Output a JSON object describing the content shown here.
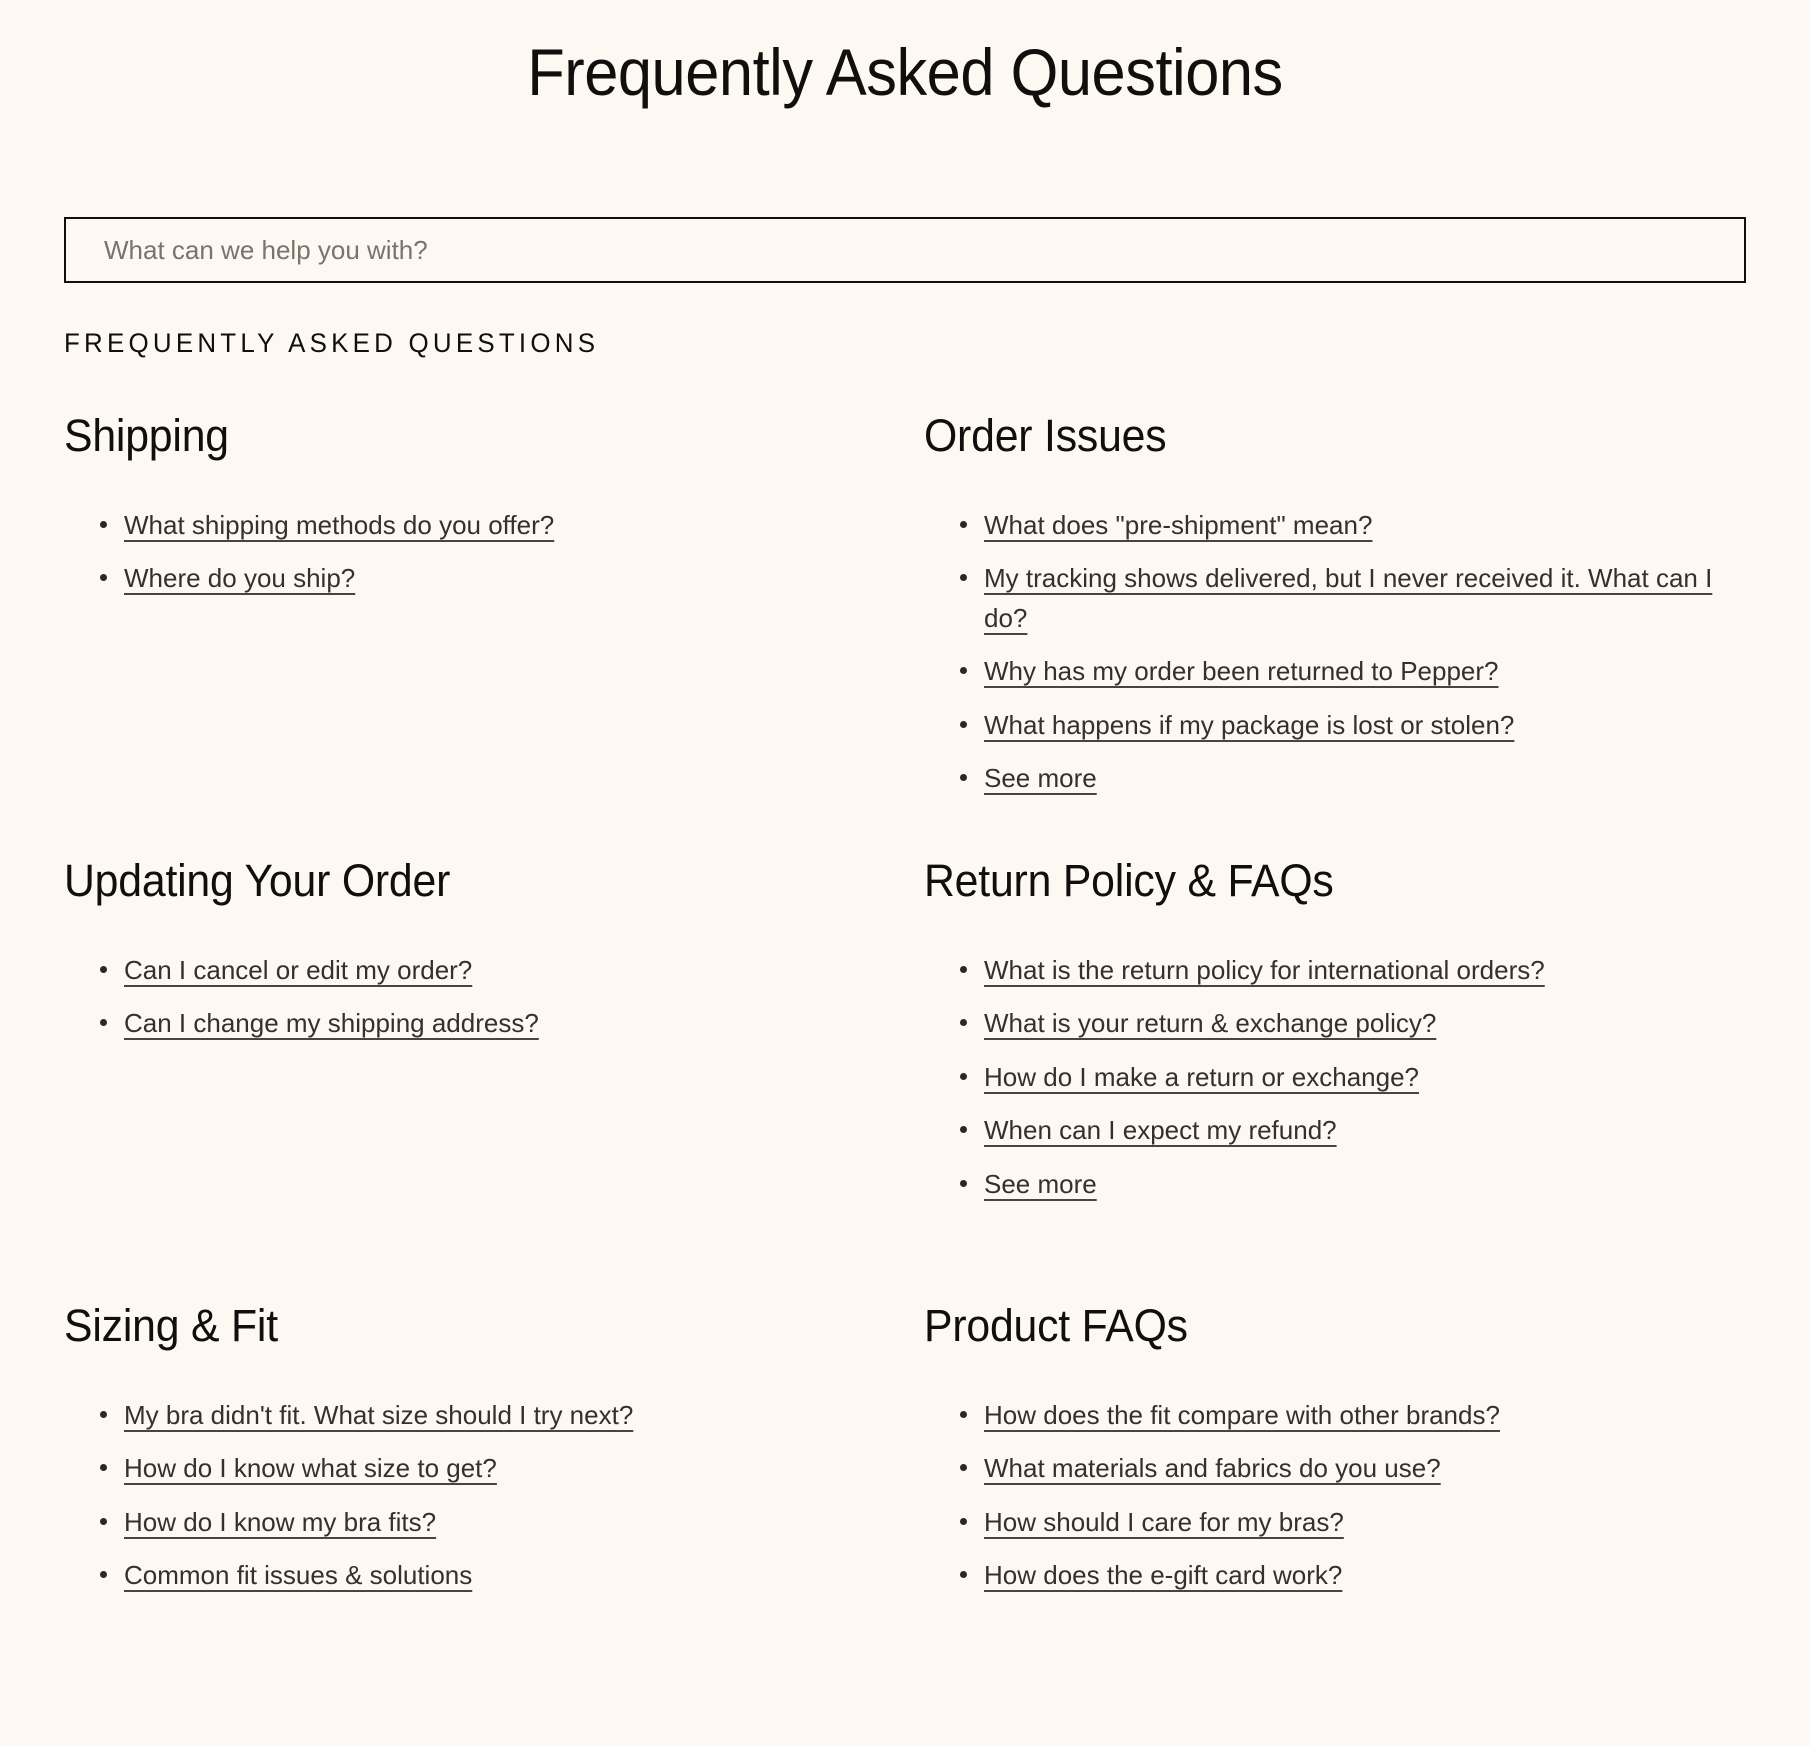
{
  "page": {
    "title": "Frequently Asked Questions",
    "eyebrow": "FREQUENTLY ASKED QUESTIONS"
  },
  "search": {
    "placeholder": "What can we help you with?",
    "value": ""
  },
  "colors": {
    "background": "#fdf8f2",
    "text": "#100f0d",
    "link": "#35302c",
    "border": "#100f0d",
    "placeholder": "#7a736d"
  },
  "sections": [
    {
      "id": "shipping",
      "heading": "Shipping",
      "links": [
        "What shipping methods do you offer?",
        "Where do you ship?"
      ]
    },
    {
      "id": "order-issues",
      "heading": "Order Issues",
      "links": [
        "What does \"pre-shipment\" mean?",
        "My tracking shows delivered, but I never received it. What can I do?",
        "Why has my order been returned to Pepper?",
        "What happens if my package is lost or stolen?",
        "See more"
      ]
    },
    {
      "id": "updating-your-order",
      "heading": "Updating Your Order",
      "links": [
        "Can I cancel or edit my order?",
        "Can I change my shipping address?"
      ]
    },
    {
      "id": "return-policy-faqs",
      "heading": "Return Policy & FAQs",
      "links": [
        "What is the return policy for international orders?",
        "What is your return & exchange policy?",
        "How do I make a return or exchange?",
        "When can I expect my refund?",
        "See more"
      ]
    },
    {
      "id": "sizing-fit",
      "heading": "Sizing & Fit",
      "links": [
        "My bra didn't fit. What size should I try next?",
        "How do I know what size to get?",
        "How do I know my bra fits?",
        "Common fit issues & solutions"
      ]
    },
    {
      "id": "product-faqs",
      "heading": "Product FAQs",
      "links": [
        "How does the fit compare with other brands?",
        "What materials and fabrics do you use?",
        "How should I care for my bras?",
        "How does the e-gift card work?"
      ]
    }
  ]
}
